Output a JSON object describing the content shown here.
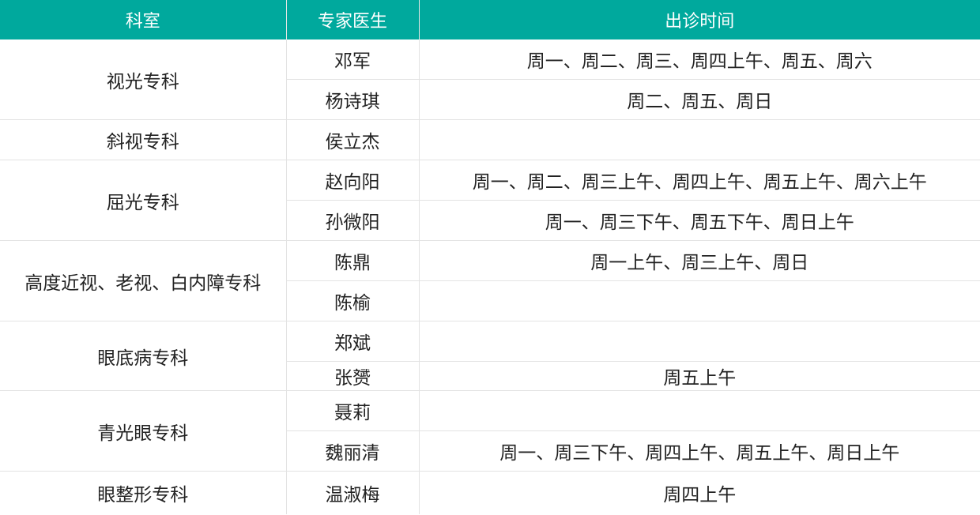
{
  "header": {
    "department": "科室",
    "doctor": "专家医生",
    "time": "出诊时间"
  },
  "departments": [
    {
      "name": "视光专科",
      "doctors": [
        {
          "name": "邓军",
          "time": "周一、周二、周三、周四上午、周五、周六"
        },
        {
          "name": "杨诗琪",
          "time": "周二、周五、周日"
        }
      ]
    },
    {
      "name": "斜视专科",
      "doctors": [
        {
          "name": "侯立杰",
          "time": ""
        }
      ]
    },
    {
      "name": "屈光专科",
      "doctors": [
        {
          "name": "赵向阳",
          "time": "周一、周二、周三上午、周四上午、周五上午、周六上午"
        },
        {
          "name": "孙微阳",
          "time": "周一、周三下午、周五下午、周日上午"
        }
      ]
    },
    {
      "name": "高度近视、老视、白内障专科",
      "doctors": [
        {
          "name": "陈鼎",
          "time": "周一上午、周三上午、周日"
        },
        {
          "name": "陈榆",
          "time": ""
        }
      ]
    },
    {
      "name": "眼底病专科",
      "doctors": [
        {
          "name": "郑斌",
          "time": ""
        },
        {
          "name": "张赟",
          "time": "周五上午"
        }
      ]
    },
    {
      "name": "青光眼专科",
      "doctors": [
        {
          "name": "聂莉",
          "time": ""
        },
        {
          "name": "魏丽清",
          "time": "周一、周三下午、周四上午、周五上午、周日上午"
        }
      ]
    },
    {
      "name": "眼整形专科",
      "doctors": [
        {
          "name": "温淑梅",
          "time": "周四上午"
        }
      ]
    }
  ]
}
